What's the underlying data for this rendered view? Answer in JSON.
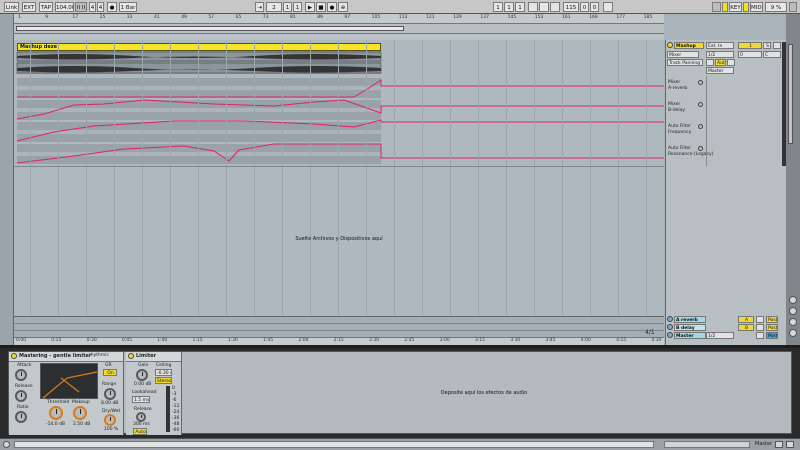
{
  "transport": {
    "link": "Link",
    "ext": "EXT",
    "tap": "TAP",
    "tempo": "104.00",
    "nudge": "II II",
    "sig_num": "4",
    "sig_den": "4",
    "metro": "●",
    "quant": "1 Bar",
    "follow": "⇥",
    "pos_bar": "2",
    "pos_beat": "1",
    "pos_sixteenth": "1",
    "play": "▶",
    "stop": "■",
    "rec": "●",
    "ovr": "⊕",
    "loop_start_bar": "1",
    "loop_start_beat": "1",
    "loop_start_sixteenth": "1",
    "loop_len_bar": "115",
    "loop_len_beat": "0",
    "loop_len_sixteenth": "0",
    "key": "KEY",
    "midi": "MIDI",
    "cpu": "9 %"
  },
  "ruler": {
    "bars": [
      "1",
      "9",
      "17",
      "25",
      "33",
      "41",
      "49",
      "57",
      "65",
      "73",
      "81",
      "89",
      "97",
      "105",
      "113",
      "121",
      "129",
      "137",
      "145",
      "153",
      "161",
      "169",
      "177",
      "185"
    ]
  },
  "timeline": {
    "marks": [
      "0:00",
      "0:15",
      "0:30",
      "0:45",
      "1:00",
      "1:15",
      "1:30",
      "1:45",
      "2:00",
      "2:15",
      "2:30",
      "2:45",
      "3:00",
      "3:15",
      "3:30",
      "3:45",
      "4:00",
      "4:15",
      "4:30"
    ],
    "ratio": "4/1"
  },
  "clip": {
    "name": "Mashup deze"
  },
  "drop_hint": "Suelte Archivos y Dispositivos aquí",
  "track": {
    "name": "Mashup",
    "input": "Ext. In",
    "input_ch": "1/2",
    "monitor": "Auto",
    "mixer_sel": "Mixer",
    "panning": "Track Panning",
    "master": "Master",
    "num": "1",
    "s": "S",
    "vol": "0",
    "pan": "C",
    "auto_lanes": [
      {
        "device": "Mixer",
        "param": "A-reverb"
      },
      {
        "device": "Mixer",
        "param": "B-delay"
      },
      {
        "device": "Auto Filter",
        "param": "Frequency"
      },
      {
        "device": "Auto Filter",
        "param": "Resonance (Legacy)"
      }
    ]
  },
  "returns": [
    {
      "name": "A reverb",
      "letter": "A",
      "post": "Post",
      "color": "#9fd9e8"
    },
    {
      "name": "B delay",
      "letter": "B",
      "post": "Post",
      "color": "#bfe3ee"
    }
  ],
  "master_track": {
    "name": "Master",
    "ch": "1/2",
    "post": "Post"
  },
  "devices": {
    "mastering": {
      "title": "Mastering - gentle limiter",
      "preset": "rhythmic",
      "attack_label": "Attack",
      "release_label": "Release",
      "ratio_label": "Ratio",
      "threshold_label": "Threshold",
      "threshold_val": "-14.0 dB",
      "makeup_label": "Makeup",
      "makeup_val": "2.50 dB",
      "gr_label": "GR",
      "ceiling_label": "Range",
      "ceiling_val": "8.00 dB",
      "drywet_label": "Dry/Wet",
      "drywet_val": "100 %",
      "on_label": "On"
    },
    "limiter": {
      "title": "Limiter",
      "gain_label": "Gain",
      "gain_val": "0.00 dB",
      "ceiling_label": "Ceiling",
      "ceiling_val": "-0.30 dB",
      "stereo_label": "Stereo",
      "lookahead_label": "Lookahead",
      "lookahead_val": "1.5 ms",
      "release_label": "Release",
      "release_val": "300 ms",
      "auto_label": "Auto",
      "meter_ticks": [
        "0",
        "-3",
        "-6",
        "-12",
        "-24",
        "-36",
        "-48",
        "-60"
      ]
    },
    "drop_hint": "Deposite aquí los efectos de audio"
  },
  "status": {
    "track": "Master"
  }
}
